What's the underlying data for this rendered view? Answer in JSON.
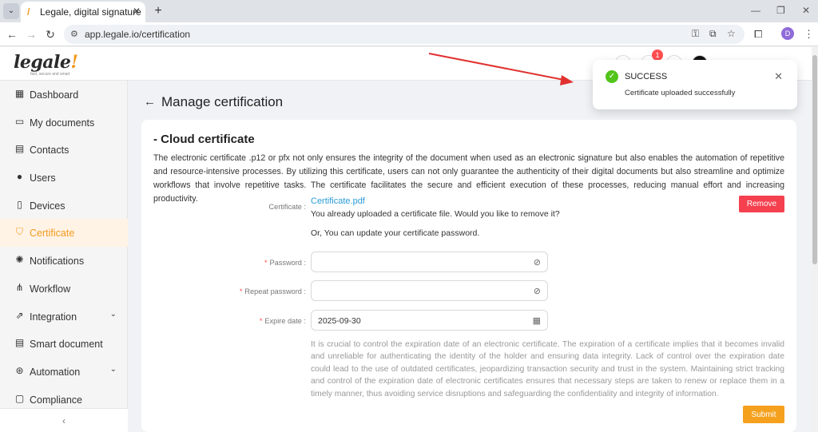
{
  "browser": {
    "tab_title": "Legale, digital signature",
    "url": "app.legale.io/certification"
  },
  "logo": {
    "text": "legale",
    "tagline": "fast, secure and smart"
  },
  "sidebar": {
    "items": [
      {
        "label": "Dashboard",
        "icon": "dashboard-icon"
      },
      {
        "label": "My documents",
        "icon": "folder-icon"
      },
      {
        "label": "Contacts",
        "icon": "contacts-icon"
      },
      {
        "label": "Users",
        "icon": "user-icon"
      },
      {
        "label": "Devices",
        "icon": "tablet-icon"
      },
      {
        "label": "Certificate",
        "icon": "shield-icon",
        "active": true
      },
      {
        "label": "Notifications",
        "icon": "bell-icon"
      },
      {
        "label": "Workflow",
        "icon": "workflow-icon"
      },
      {
        "label": "Integration",
        "icon": "link-icon",
        "expandable": true
      },
      {
        "label": "Smart document",
        "icon": "document-icon"
      },
      {
        "label": "Automation",
        "icon": "automation-icon",
        "expandable": true
      },
      {
        "label": "Compliance",
        "icon": "message-icon"
      }
    ],
    "collapse": "‹"
  },
  "header": {
    "notification_count": "1"
  },
  "page": {
    "title": "Manage certification"
  },
  "card": {
    "title": "- Cloud certificate",
    "description": "The electronic certificate .p12 or pfx not only ensures the integrity of the document when used as an electronic signature but also enables the automation of repetitive and resource-intensive processes. By utilizing this certificate, users can not only guarantee the authenticity of their digital documents but also streamline and optimize workflows that involve repetitive tasks. The certificate facilitates the secure and efficient execution of these processes, reducing manual effort and increasing productivity."
  },
  "form": {
    "certificate_label": "Certificate :",
    "certificate_file": "Certificate.pdf",
    "uploaded_text": "You already uploaded a certificate file. Would you like to remove it?",
    "update_text": "Or, You can update your certificate password.",
    "remove_button": "Remove",
    "password_label": "Password :",
    "repeat_password_label": "Repeat password :",
    "expire_label": "Expire date :",
    "expire_value": "2025-09-30",
    "note": "It is crucial to control the expiration date of an electronic certificate. The expiration of a certificate implies that it becomes invalid and unreliable for authenticating the identity of the holder and ensuring data integrity. Lack of control over the expiration date could lead to the use of outdated certificates, jeopardizing transaction security and trust in the system. Maintaining strict tracking and control of the expiration date of electronic certificates ensures that necessary steps are taken to renew or replace them in a timely manner, thus avoiding service disruptions and safeguarding the confidentiality and integrity of information.",
    "submit_button": "Submit"
  },
  "toast": {
    "title": "SUCCESS",
    "message": "Certificate uploaded successfully"
  },
  "colors": {
    "accent": "#f29a1e",
    "danger": "#f5404f",
    "success": "#52c41a",
    "link": "#2b9bd6",
    "annotation_arrow": "#e0312f"
  }
}
